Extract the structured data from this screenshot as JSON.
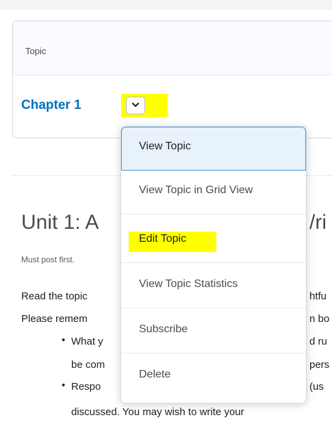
{
  "topic_table": {
    "header_label": "Topic",
    "chapter_link": "Chapter 1"
  },
  "content": {
    "unit_title_left": "Unit 1: A",
    "unit_title_right": "/ri",
    "must_post": "Must post first.",
    "paragraph_fragments": [
      {
        "left": "Read the topic",
        "right": "htfu"
      },
      {
        "left": "Please remem",
        "right": "n bo"
      }
    ],
    "bullets": [
      {
        "left": "What y",
        "right": "d ru",
        "cont_left": "be com",
        "cont_right": "pers"
      },
      {
        "left": "Respo",
        "right": "(us",
        "cont_full": "discussed. You may wish to write your"
      }
    ]
  },
  "dropdown_menu": {
    "items": [
      {
        "label": "View Topic"
      },
      {
        "label": "View Topic in Grid View"
      },
      {
        "label": "Edit Topic"
      },
      {
        "label": "View Topic Statistics"
      },
      {
        "label": "Subscribe"
      },
      {
        "label": "Delete"
      }
    ]
  },
  "colors": {
    "link": "#006fbf",
    "highlight": "#ffff00",
    "focus_border": "#3e9bd9",
    "focus_bg": "#e8f2fa"
  }
}
